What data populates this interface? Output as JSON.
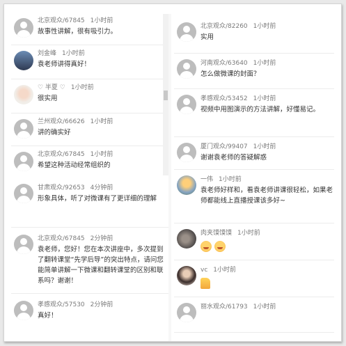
{
  "left_top": [
    {
      "user": "北京观众/67845",
      "time": "1小时前",
      "text": "故事性讲解，很有吸引力。",
      "avatar": "default"
    },
    {
      "user": "刘金峰",
      "time": "1小时前",
      "text": "袁老师讲得真好！",
      "avatar": "photo1"
    },
    {
      "user": "♡ 半夏 ♡",
      "time": "1小时前",
      "text": "很实用",
      "avatar": "photo2"
    },
    {
      "user": "兰州观众/66626",
      "time": "1小时前",
      "text": "讲的确实好",
      "avatar": "default"
    },
    {
      "user": "北京观众/67845",
      "time": "1小时前",
      "text": "希望这种活动经常组织的",
      "avatar": "default"
    }
  ],
  "left_bottom": [
    {
      "user": "甘肃观众/92653",
      "time": "4分钟前",
      "text": "形象具体，听了对微课有了更详细的理解",
      "avatar": "default"
    },
    {
      "user": "北京观众/67845",
      "time": "2分钟前",
      "text": "袁老师，您好！您在本次讲座中，多次提到了翻转课堂“先学后导”的突出特点，请问您能简单讲解一下微课和翻转课堂的区别和联系吗？谢谢！",
      "avatar": "default"
    },
    {
      "user": "孝感观众/57530",
      "time": "2分钟前",
      "text": "真好！",
      "avatar": "default"
    }
  ],
  "right": [
    {
      "user": "北京观众/82260",
      "time": "1小时前",
      "text": "实用",
      "avatar": "default"
    },
    {
      "user": "河南观众/63640",
      "time": "1小时前",
      "text": "怎么做微课的封面？",
      "avatar": "default"
    },
    {
      "user": "孝感观众/53452",
      "time": "1小时前",
      "text": "视频中用图演示的方法讲解，好懂易记。",
      "avatar": "default"
    },
    {
      "user": "厦门观众/99407",
      "time": "1小时前",
      "text": "谢谢袁老师的答疑解惑",
      "avatar": "default"
    },
    {
      "user": "一伟",
      "time": "1小时前",
      "text": "袁老师好样和，看袁老师讲课很轻松，如果老师都能线上直播授课该多好~",
      "avatar": "photo3"
    },
    {
      "user": "肉夹馍馍馍",
      "time": "1小时前",
      "text": "",
      "avatar": "photo4",
      "emojis": [
        "smile-emoji",
        "smile-emoji"
      ]
    },
    {
      "user": "vc",
      "time": "1小时前",
      "text": "",
      "avatar": "photo5",
      "emojis": [
        "thumbs-up-emoji"
      ]
    },
    {
      "user": "丽水观众/61793",
      "time": "1小时前",
      "text": "",
      "avatar": "default"
    }
  ]
}
